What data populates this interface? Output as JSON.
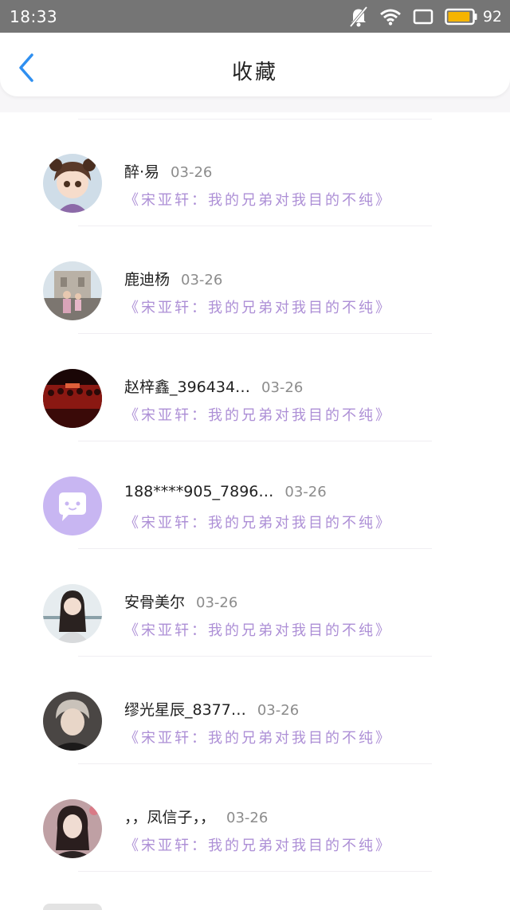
{
  "status_bar": {
    "time": "18:33",
    "icons": [
      "mute-bell-icon",
      "wifi-icon",
      "screen-icon",
      "battery-icon"
    ],
    "battery_level": "92",
    "battery_color": "#f5b400"
  },
  "header": {
    "title": "收藏",
    "back_icon": "chevron-left-icon",
    "accent_color": "#2f8ff0"
  },
  "favorites": [
    {
      "name": "醉·易",
      "date": "03-26",
      "preview": "《宋亚轩：我的兄弟对我目的不纯》"
    },
    {
      "name": "鹿迪杨",
      "date": "03-26",
      "preview": "《宋亚轩：我的兄弟对我目的不纯》"
    },
    {
      "name": "赵梓鑫_396434…",
      "date": "03-26",
      "preview": "《宋亚轩：我的兄弟对我目的不纯》"
    },
    {
      "name": "188****905_7896…",
      "date": "03-26",
      "preview": "《宋亚轩：我的兄弟对我目的不纯》"
    },
    {
      "name": "安骨美尔",
      "date": "03-26",
      "preview": "《宋亚轩：我的兄弟对我目的不纯》"
    },
    {
      "name": "缪光星辰_8377…",
      "date": "03-26",
      "preview": "《宋亚轩：我的兄弟对我目的不纯》"
    },
    {
      "name": "，，凤信子，，",
      "date": "03-26",
      "preview": "《宋亚轩：我的兄弟对我目的不纯》"
    }
  ],
  "colors": {
    "preview_text": "#ad8fd6",
    "default_avatar_bg": "#c8b6f2",
    "date_text": "#8c8c8c"
  }
}
